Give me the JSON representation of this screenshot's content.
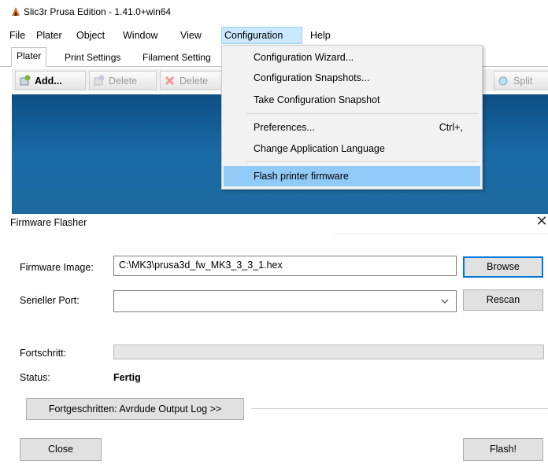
{
  "window": {
    "title": "Slic3r Prusa Edition - 1.41.0+win64"
  },
  "menubar": {
    "items": [
      {
        "label": "File"
      },
      {
        "label": "Plater"
      },
      {
        "label": "Object"
      },
      {
        "label": "Window"
      },
      {
        "label": "View"
      },
      {
        "label": "Configuration"
      },
      {
        "label": "Help"
      }
    ]
  },
  "tabs": [
    {
      "label": "Plater"
    },
    {
      "label": "Print Settings"
    },
    {
      "label": "Filament Setting"
    }
  ],
  "toolbar": {
    "add_label": "Add...",
    "delete_label": "Delete",
    "delete_all_label": "Delete",
    "split_label": "Split"
  },
  "config_menu": {
    "items": [
      {
        "label": "Configuration Wizard...",
        "shortcut": ""
      },
      {
        "label": "Configuration Snapshots...",
        "shortcut": ""
      },
      {
        "label": "Take Configuration Snapshot",
        "shortcut": ""
      },
      {
        "label": "Preferences...",
        "shortcut": "Ctrl+,"
      },
      {
        "label": "Change Application Language",
        "shortcut": ""
      },
      {
        "label": "Flash printer firmware",
        "shortcut": ""
      }
    ]
  },
  "dialog": {
    "title": "Firmware Flasher",
    "close_symbol": "✕",
    "firmware_label": "Firmware Image:",
    "firmware_value": "C:\\MK3\\prusa3d_fw_MK3_3_3_1.hex",
    "browse_label": "Browse",
    "port_label": "Serieller Port:",
    "port_value": "",
    "rescan_label": "Rescan",
    "progress_label": "Fortschritt:",
    "progress_value": 0,
    "status_label": "Status:",
    "status_value": "Fertig",
    "advanced_label": "Fortgeschritten: Avrdude Output Log >>",
    "close_label": "Close",
    "flash_label": "Flash!"
  },
  "colors": {
    "menu_highlight": "#91c9f7",
    "plater_background": "#1a6aa6",
    "default_button_border": "#0078d7"
  }
}
